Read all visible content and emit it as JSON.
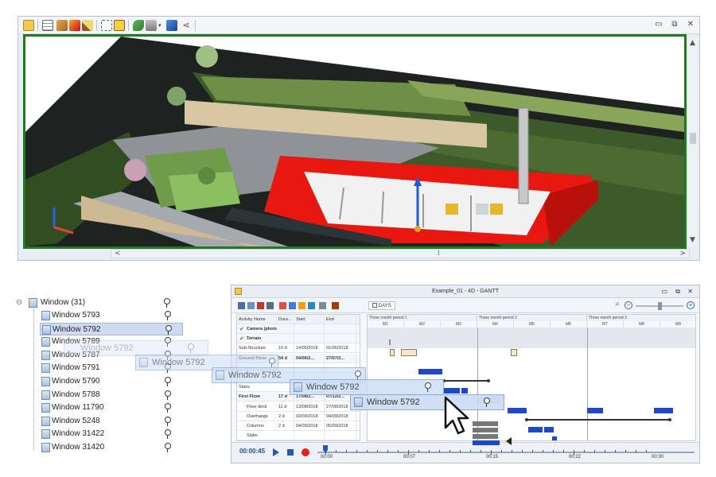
{
  "viewer": {
    "toolbar_icons": [
      "properties-icon",
      "table-icon",
      "render-icon",
      "lighting-icon",
      "draw-icon",
      "select-icon",
      "select-box-icon",
      "paint-icon",
      "camera-icon",
      "dropdown-icon",
      "walk-icon",
      "share-icon"
    ],
    "window_controls": {
      "minimize": "▭",
      "restore": "⧉",
      "close": "✕"
    },
    "scrollbar": {
      "left_arrow": "<",
      "right_arrow": ">",
      "up_arrow": "▲",
      "down_arrow": "▼",
      "thumb": "⁞"
    }
  },
  "tree": {
    "collapse_glyph": "⊖",
    "root_label": "Window (31)",
    "items": [
      "Window 5793",
      "Window 5792",
      "Window 5789",
      "Window 5787",
      "Window 5791",
      "Window 5790",
      "Window 5788",
      "Window 11790",
      "Window 5248",
      "Window 31422",
      "Window 31420"
    ],
    "selected_index": 1
  },
  "drag": {
    "ghost_label": "Window 5792"
  },
  "gantt": {
    "title": "Example_01 - 4D - GANTT",
    "zoom_unit": "DAYS",
    "columns": [
      "Activity Name",
      "Dura...",
      "Start",
      "End"
    ],
    "rows": [
      {
        "name": "Camera (photoreels)",
        "dur": "",
        "start": "",
        "end": "",
        "bold": true,
        "check": true
      },
      {
        "name": "Terrain",
        "dur": "",
        "start": "",
        "end": "",
        "bold": true,
        "check": true
      },
      {
        "name": "Sub-Structure",
        "dur": "19 d",
        "start": "14/05/2018",
        "end": "01/06/2018",
        "bold": false,
        "check": false
      },
      {
        "name": "Ground Floor",
        "dur": "54 d",
        "start": "04/06/2...",
        "end": "27/07/2...",
        "bold": true,
        "check": false
      },
      {
        "name": "",
        "dur": "",
        "start": "",
        "end": "",
        "bold": false,
        "check": false
      },
      {
        "name": "",
        "dur": "",
        "start": "",
        "end": "",
        "bold": false,
        "check": false
      },
      {
        "name": "Stairs",
        "dur": "",
        "start": "",
        "end": "",
        "bold": false,
        "check": false
      },
      {
        "name": "First Floor",
        "dur": "17 d",
        "start": "17/08/2...",
        "end": "07/12/2...",
        "bold": true,
        "check": false
      },
      {
        "name": "Floor deck",
        "dur": "11 d",
        "start": "13/08/2018",
        "end": "27/08/2018",
        "bold": false,
        "check": false
      },
      {
        "name": "Overhangs",
        "dur": "2 d",
        "start": "03/09/2018",
        "end": "04/09/2018",
        "bold": false,
        "check": false
      },
      {
        "name": "Columns",
        "dur": "2 d",
        "start": "04/09/2018",
        "end": "05/09/2018",
        "bold": false,
        "check": false
      },
      {
        "name": "Slabs",
        "dur": "",
        "start": "",
        "end": "",
        "bold": false,
        "check": false
      }
    ],
    "periods": [
      "Three month period 1",
      "Three month period 2",
      "Three month period 3"
    ],
    "weeks": [
      "M1",
      "M2",
      "M3",
      "M4",
      "M5",
      "M6",
      "M7",
      "M8",
      "M9"
    ],
    "timeline": {
      "time": "00:00:45",
      "ticks": [
        "00:00",
        "00:07",
        "00:15",
        "00:22",
        "00:30"
      ]
    },
    "window_controls": {
      "minimize": "▭",
      "restore": "⧉",
      "close": "✕"
    },
    "zoom_glyphs": {
      "search": "⌕",
      "minus": "−",
      "plus": "+"
    }
  },
  "colors": {
    "accent": "#2d5fb8",
    "task_blue": "#1c48c9",
    "delay_red": "#e2231a",
    "viewport_border": "#1f7a1f"
  }
}
